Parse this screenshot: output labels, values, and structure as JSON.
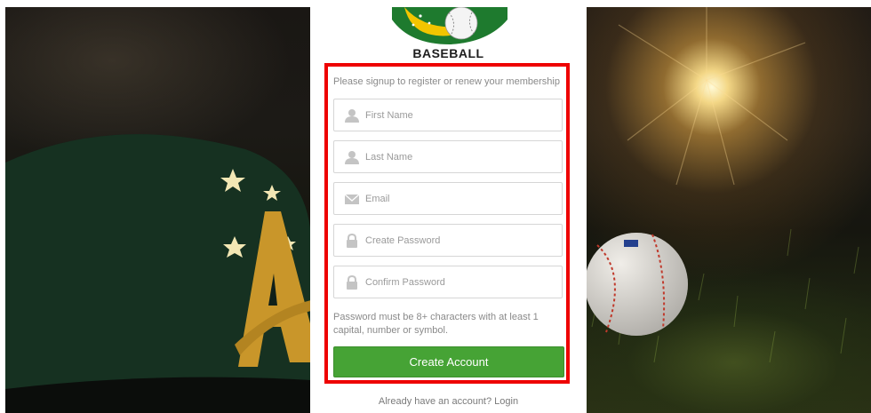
{
  "brand": {
    "name": "BASEBALL",
    "logo_icon": "baseball-australia-logo"
  },
  "form": {
    "intro": "Please signup to register or renew your membership",
    "fields": [
      {
        "icon": "user-icon",
        "placeholder": "First Name",
        "type": "text"
      },
      {
        "icon": "user-icon",
        "placeholder": "Last Name",
        "type": "text"
      },
      {
        "icon": "envelope-icon",
        "placeholder": "Email",
        "type": "email"
      },
      {
        "icon": "lock-icon",
        "placeholder": "Create Password",
        "type": "password"
      },
      {
        "icon": "lock-icon",
        "placeholder": "Confirm Password",
        "type": "password"
      }
    ],
    "password_hint": "Password must be 8+ characters with at least 1 capital, number or symbol.",
    "submit_label": "Create Account",
    "login_prompt": "Already have an account? Login"
  },
  "colors": {
    "button": "#46a335",
    "highlight_border": "#ee0000",
    "logo_green": "#1e7a2e",
    "logo_gold": "#f2c500"
  }
}
